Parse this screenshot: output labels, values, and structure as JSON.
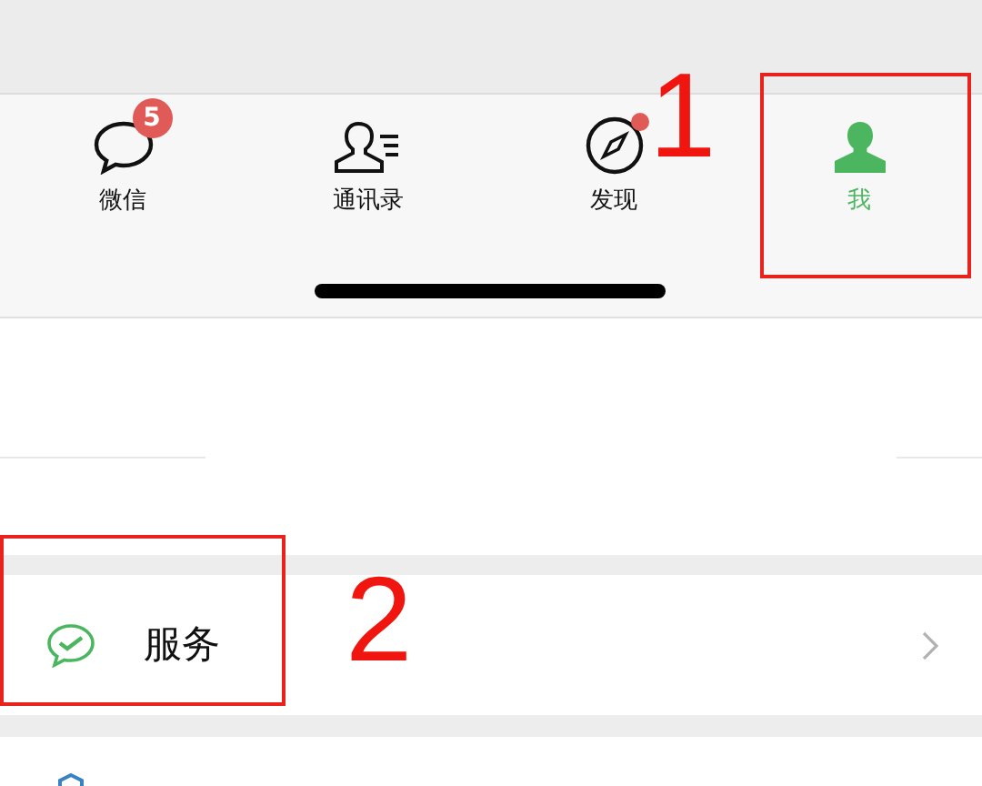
{
  "tab_bar": {
    "tabs": [
      {
        "kind": "chats",
        "label": "微信",
        "selected": false,
        "badge": "5"
      },
      {
        "kind": "contacts",
        "label": "通讯录",
        "selected": false
      },
      {
        "kind": "discover",
        "label": "发现",
        "selected": false,
        "dot": true
      },
      {
        "kind": "me",
        "label": "我",
        "selected": true
      }
    ]
  },
  "menu": [
    {
      "kind": "services",
      "label": "服务"
    }
  ],
  "annotations": [
    {
      "kind": "tab",
      "number": "1"
    },
    {
      "kind": "row",
      "number": "2"
    }
  ]
}
